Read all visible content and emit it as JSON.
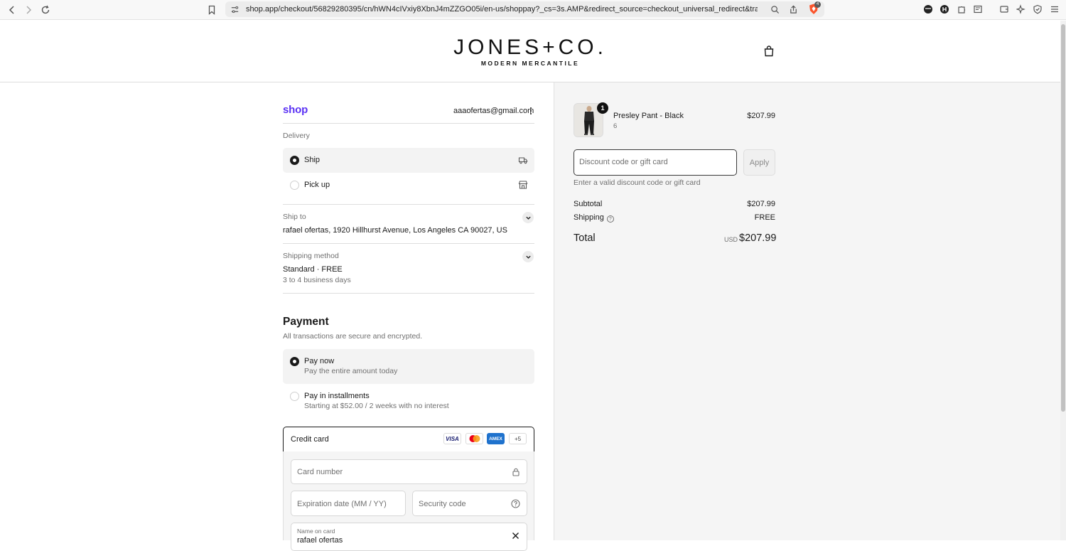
{
  "browser": {
    "url": "shop.app/checkout/56829280395/cn/hWN4cIVxiy8XbnJ4mZZGO05i/en-us/shoppay?_cs=3s.AMP&redirect_source=checkout_universal_redirect&trac...",
    "shield_badge": "4"
  },
  "header": {
    "logo_main": "JONES+CO.",
    "logo_sub": "MODERN MERCANTILE"
  },
  "account": {
    "shop_logo": "shop",
    "email": "aaaofertas@gmail.com"
  },
  "delivery": {
    "label": "Delivery",
    "options": [
      {
        "label": "Ship",
        "selected": true,
        "icon": "truck-icon"
      },
      {
        "label": "Pick up",
        "selected": false,
        "icon": "store-icon"
      }
    ]
  },
  "ship_to": {
    "label": "Ship to",
    "address": "rafael ofertas, 1920 Hillhurst Avenue, Los Angeles CA 90027, US"
  },
  "shipping_method": {
    "label": "Shipping method",
    "method": "Standard · FREE",
    "eta": "3 to 4 business days"
  },
  "payment": {
    "heading": "Payment",
    "subheading": "All transactions are secure and encrypted.",
    "options": [
      {
        "label": "Pay now",
        "sub": "Pay the entire amount today",
        "selected": true
      },
      {
        "label": "Pay in installments",
        "sub": "Starting at $52.00 / 2 weeks with no interest",
        "selected": false
      }
    ],
    "credit_card": {
      "label": "Credit card",
      "brands": [
        "VISA",
        "",
        "AMEX",
        "+5"
      ],
      "card_number_placeholder": "Card number",
      "expiry_placeholder": "Expiration date (MM / YY)",
      "security_placeholder": "Security code",
      "name_label": "Name on card",
      "name_value": "rafael ofertas"
    }
  },
  "order": {
    "item": {
      "name": "Presley Pant - Black",
      "variant": "6",
      "price": "$207.99",
      "quantity": "1"
    },
    "discount_placeholder": "Discount code or gift card",
    "apply_label": "Apply",
    "discount_hint": "Enter a valid discount code or gift card",
    "subtotal_label": "Subtotal",
    "subtotal_value": "$207.99",
    "shipping_label": "Shipping",
    "shipping_value": "FREE",
    "total_label": "Total",
    "currency": "USD",
    "total_value": "$207.99"
  },
  "colors": {
    "shop_brand": "#5a31f4",
    "accent": "#1a1a1a",
    "amex": "#1f72cd"
  }
}
